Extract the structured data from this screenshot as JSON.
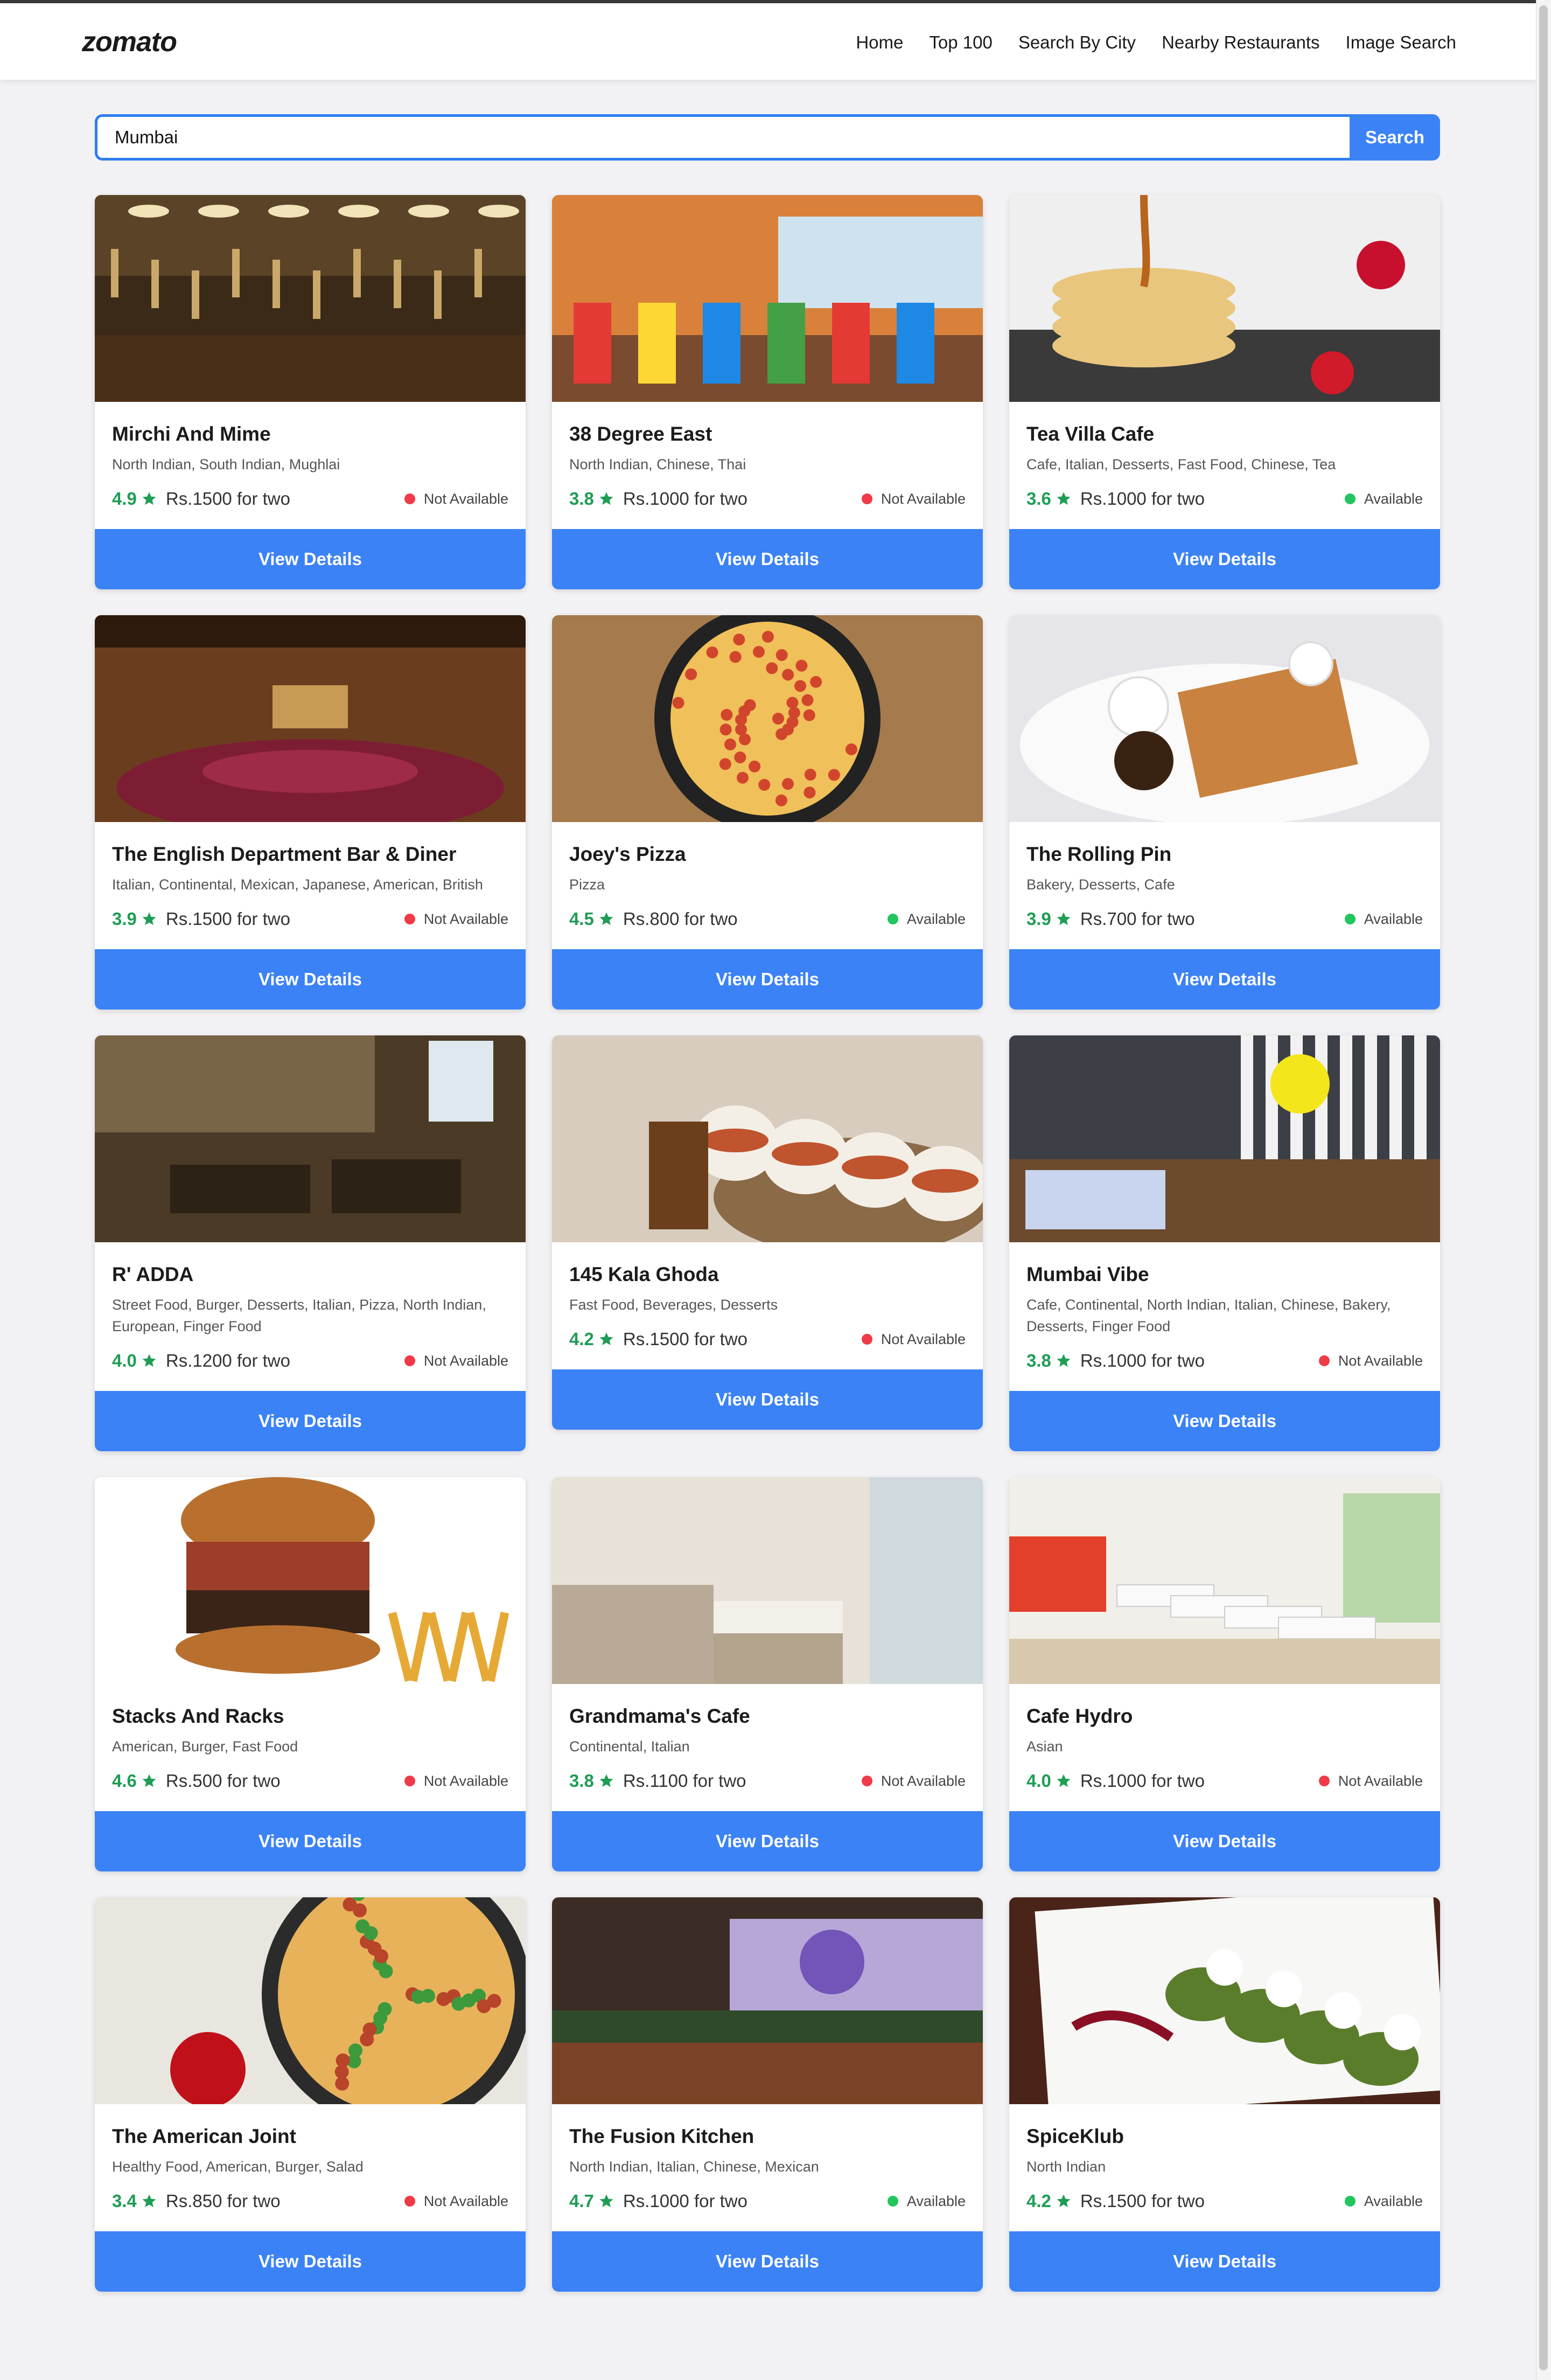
{
  "brand": {
    "logo_text": "zomato"
  },
  "nav": {
    "items": [
      "Home",
      "Top 100",
      "Search By City",
      "Nearby Restaurants",
      "Image Search"
    ]
  },
  "search": {
    "value": "Mumbai",
    "button_label": "Search"
  },
  "card_button_label": "View Details",
  "colors": {
    "accent": "#3b82f6",
    "rating": "#1f9d55",
    "available": "#22c55e",
    "not_available": "#ef3a47"
  },
  "restaurants": [
    {
      "name": "Mirchi And Mime",
      "cuisines": "North Indian, South Indian, Mughlai",
      "rating": "4.9",
      "price": "Rs.1500 for two",
      "status": "Not Available",
      "image": "restaurant-interior-photo"
    },
    {
      "name": "38 Degree East",
      "cuisines": "North Indian, Chinese, Thai",
      "rating": "3.8",
      "price": "Rs.1000 for two",
      "status": "Not Available",
      "image": "colorful-dining-room-photo"
    },
    {
      "name": "Tea Villa Cafe",
      "cuisines": "Cafe, Italian, Desserts, Fast Food, Chinese, Tea",
      "rating": "3.6",
      "price": "Rs.1000 for two",
      "status": "Available",
      "image": "pancakes-photo"
    },
    {
      "name": "The English Department Bar & Diner",
      "cuisines": "Italian, Continental, Mexican, Japanese, American, British",
      "rating": "3.9",
      "price": "Rs.1500 for two",
      "status": "Not Available",
      "image": "bar-interior-photo"
    },
    {
      "name": "Joey's Pizza",
      "cuisines": "Pizza",
      "rating": "4.5",
      "price": "Rs.800 for two",
      "status": "Available",
      "image": "pizza-photo"
    },
    {
      "name": "The Rolling Pin",
      "cuisines": "Bakery, Desserts, Cafe",
      "rating": "3.9",
      "price": "Rs.700 for two",
      "status": "Available",
      "image": "waffles-photo"
    },
    {
      "name": "R' ADDA",
      "cuisines": "Street Food, Burger, Desserts, Italian, Pizza, North Indian, European, Finger Food",
      "rating": "4.0",
      "price": "Rs.1200 for two",
      "status": "Not Available",
      "image": "pub-interior-photo"
    },
    {
      "name": "145 Kala Ghoda",
      "cuisines": "Fast Food, Beverages, Desserts",
      "rating": "4.2",
      "price": "Rs.1500 for two",
      "status": "Not Available",
      "image": "bao-buns-photo"
    },
    {
      "name": "Mumbai Vibe",
      "cuisines": "Cafe, Continental, North Indian, Italian, Chinese, Bakery, Desserts, Finger Food",
      "rating": "3.8",
      "price": "Rs.1000 for two",
      "status": "Not Available",
      "image": "cafe-interior-photo"
    },
    {
      "name": "Stacks And Racks",
      "cuisines": "American, Burger, Fast Food",
      "rating": "4.6",
      "price": "Rs.500 for two",
      "status": "Not Available",
      "image": "burger-photo"
    },
    {
      "name": "Grandmama's Cafe",
      "cuisines": "Continental, Italian",
      "rating": "3.8",
      "price": "Rs.1100 for two",
      "status": "Not Available",
      "image": "cafe-seating-photo"
    },
    {
      "name": "Cafe Hydro",
      "cuisines": "Asian",
      "rating": "4.0",
      "price": "Rs.1000 for two",
      "status": "Not Available",
      "image": "bright-cafe-photo"
    },
    {
      "name": "The American Joint",
      "cuisines": "Healthy Food, American, Burger, Salad",
      "rating": "3.4",
      "price": "Rs.850 for two",
      "status": "Not Available",
      "image": "pizza-with-ketchup-photo"
    },
    {
      "name": "The Fusion Kitchen",
      "cuisines": "North Indian, Italian, Chinese, Mexican",
      "rating": "4.7",
      "price": "Rs.1000 for two",
      "status": "Available",
      "image": "graffiti-dining-photo"
    },
    {
      "name": "SpiceKlub",
      "cuisines": "North Indian",
      "rating": "4.2",
      "price": "Rs.1500 for two",
      "status": "Available",
      "image": "plated-dish-photo"
    }
  ]
}
